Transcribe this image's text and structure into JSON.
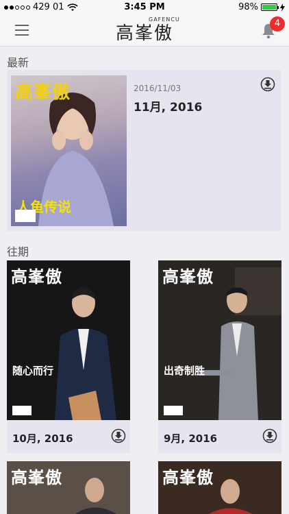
{
  "status_bar": {
    "carrier": "429 01",
    "time": "3:45 PM",
    "battery": "98%",
    "battery_level": 0.98
  },
  "nav": {
    "logo": "高峯傲",
    "logo_sub": "GAFENCU",
    "notification_count": "4"
  },
  "sections": {
    "latest": "最新",
    "past": "往期"
  },
  "latest": {
    "date": "2016/11/03",
    "title": "11月, 2016",
    "cover_masthead": "高峯傲",
    "cover_headline": "人鱼传说"
  },
  "past_issues": [
    {
      "label": "10月, 2016",
      "masthead": "高峯傲",
      "headline": "随心而行"
    },
    {
      "label": "9月, 2016",
      "masthead": "高峯傲",
      "headline": "出奇制胜"
    },
    {
      "label": "",
      "masthead": "高峯傲",
      "headline": ""
    },
    {
      "label": "",
      "masthead": "高峯傲",
      "headline": ""
    }
  ],
  "colors": {
    "background": "#efeef3",
    "card": "#e6e5ef",
    "badge": "#f02c2c"
  },
  "icons": {
    "menu": "hamburger-icon",
    "notifications": "bell-icon",
    "download": "download-circle-icon"
  }
}
